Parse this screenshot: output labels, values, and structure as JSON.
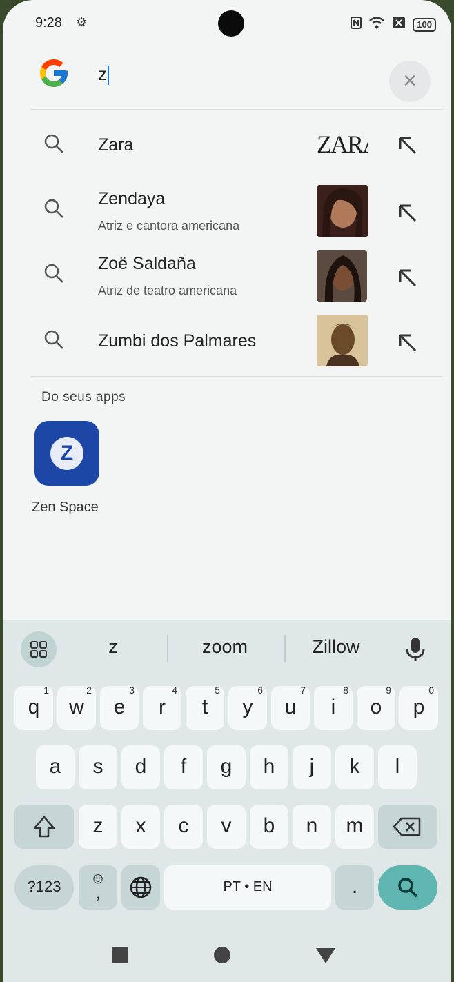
{
  "status_bar": {
    "time": "9:28",
    "battery": "100",
    "icons": [
      "settings-icon",
      "nfc-icon",
      "wifi-icon",
      "x-icon",
      "battery-icon"
    ]
  },
  "search": {
    "logo": "google-logo-icon",
    "query": "z",
    "clear_icon": "close-icon"
  },
  "suggestions": [
    {
      "title": "Zara",
      "subtitle": "",
      "thumb": "zara-logo",
      "thumb_text": "ZARA"
    },
    {
      "title": "Zendaya",
      "subtitle": "Atriz e cantora americana",
      "thumb": "person-photo"
    },
    {
      "title": "Zoë Saldaña",
      "subtitle": "Atriz de teatro americana",
      "thumb": "person-photo"
    },
    {
      "title": "Zumbi dos Palmares",
      "subtitle": "",
      "thumb": "portrait-drawing"
    }
  ],
  "apps_section": {
    "label": "Do seus apps",
    "apps": [
      {
        "name": "Zen Space",
        "icon_letter": "Z",
        "color": "#1c47a6"
      }
    ]
  },
  "keyboard": {
    "word_suggestions": [
      "z",
      "zoom",
      "Zillow"
    ],
    "row1": [
      {
        "k": "q",
        "n": "1"
      },
      {
        "k": "w",
        "n": "2"
      },
      {
        "k": "e",
        "n": "3"
      },
      {
        "k": "r",
        "n": "4"
      },
      {
        "k": "t",
        "n": "5"
      },
      {
        "k": "y",
        "n": "6"
      },
      {
        "k": "u",
        "n": "7"
      },
      {
        "k": "i",
        "n": "8"
      },
      {
        "k": "o",
        "n": "9"
      },
      {
        "k": "p",
        "n": "0"
      }
    ],
    "row2": [
      "a",
      "s",
      "d",
      "f",
      "g",
      "h",
      "j",
      "k",
      "l"
    ],
    "row3": [
      "z",
      "x",
      "c",
      "v",
      "b",
      "n",
      "m"
    ],
    "symbols_label": "?123",
    "emoji_key": "☺",
    "comma_key": ",",
    "space_label": "PT • EN",
    "period_key": ".",
    "accent": "#5fb5b0"
  },
  "nav_bar": {
    "recents": "recents-icon",
    "home": "home-icon",
    "back": "back-icon"
  }
}
